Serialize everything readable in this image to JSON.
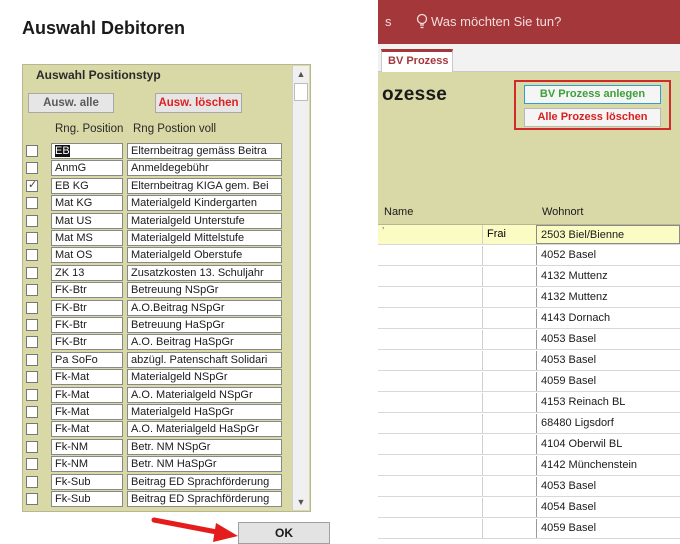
{
  "dialog": {
    "title": "Auswahl Debitoren",
    "panel_title": "Auswahl Positionstyp",
    "select_all_label": "Ausw. alle",
    "clear_selection_label": "Ausw. löschen",
    "header_position": "Rng. Position",
    "header_full": "Rng Postion voll",
    "ok_label": "OK",
    "rows": [
      {
        "pos": "EB",
        "full": "Elternbeitrag gemäss Beitra",
        "checked": false
      },
      {
        "pos": "AnmG",
        "full": "Anmeldegebühr",
        "checked": false
      },
      {
        "pos": "EB KG",
        "full": "Elternbeitrag KIGA gem. Bei",
        "checked": true
      },
      {
        "pos": "Mat KG",
        "full": "Materialgeld Kindergarten",
        "checked": false
      },
      {
        "pos": "Mat US",
        "full": "Materialgeld Unterstufe",
        "checked": false
      },
      {
        "pos": "Mat MS",
        "full": "Materialgeld Mittelstufe",
        "checked": false
      },
      {
        "pos": "Mat OS",
        "full": "Materialgeld Oberstufe",
        "checked": false
      },
      {
        "pos": "ZK 13",
        "full": "Zusatzkosten 13. Schuljahr",
        "checked": false
      },
      {
        "pos": "FK-Btr",
        "full": "Betreuung NSpGr",
        "checked": false
      },
      {
        "pos": "FK-Btr",
        "full": "A.O.Beitrag NSpGr",
        "checked": false
      },
      {
        "pos": "FK-Btr",
        "full": "Betreuung HaSpGr",
        "checked": false
      },
      {
        "pos": "FK-Btr",
        "full": "A.O. Beitrag HaSpGr",
        "checked": false
      },
      {
        "pos": "Pa SoFo",
        "full": "abzügl. Patenschaft Solidari",
        "checked": false
      },
      {
        "pos": "Fk-Mat",
        "full": "Materialgeld NSpGr",
        "checked": false
      },
      {
        "pos": "Fk-Mat",
        "full": "A.O. Materialgeld NSpGr",
        "checked": false
      },
      {
        "pos": "Fk-Mat",
        "full": "Materialgeld HaSpGr",
        "checked": false
      },
      {
        "pos": "Fk-Mat",
        "full": "A.O. Materialgeld HaSpGr",
        "checked": false
      },
      {
        "pos": "Fk-NM",
        "full": "Betr. NM NSpGr",
        "checked": false
      },
      {
        "pos": "Fk-NM",
        "full": "Betr. NM HaSpGr",
        "checked": false
      },
      {
        "pos": "Fk-Sub",
        "full": "Beitrag ED Sprachförderung",
        "checked": false
      },
      {
        "pos": "Fk-Sub",
        "full": "Beitrag ED Sprachförderung",
        "checked": false
      }
    ]
  },
  "app": {
    "ribbon_left": "s",
    "help_text": "Was möchten Sie tun?",
    "tab_label": "BV Prozess",
    "form_title": "ozesse",
    "create_button": "BV Prozess anlegen",
    "delete_all_button": "Alle Prozess löschen",
    "col_name": "Name",
    "col_wohnort": "Wohnort",
    "first_row_mid": "Frai",
    "wohnorte": [
      "2503 Biel/Bienne",
      "4052 Basel",
      "4132 Muttenz",
      "4132 Muttenz",
      "4143 Dornach",
      "4053 Basel",
      "4053 Basel",
      "4059 Basel",
      "4153 Reinach BL",
      "68480 Ligsdorf",
      "4104 Oberwil BL",
      "4142 Münchenstein",
      "4053 Basel",
      "4054 Basel",
      "4059 Basel"
    ]
  },
  "colors": {
    "panel_bg": "#d9d8a7",
    "ribbon": "#a4373a",
    "accent_red": "#e02020",
    "accent_green": "#3aa03a"
  }
}
